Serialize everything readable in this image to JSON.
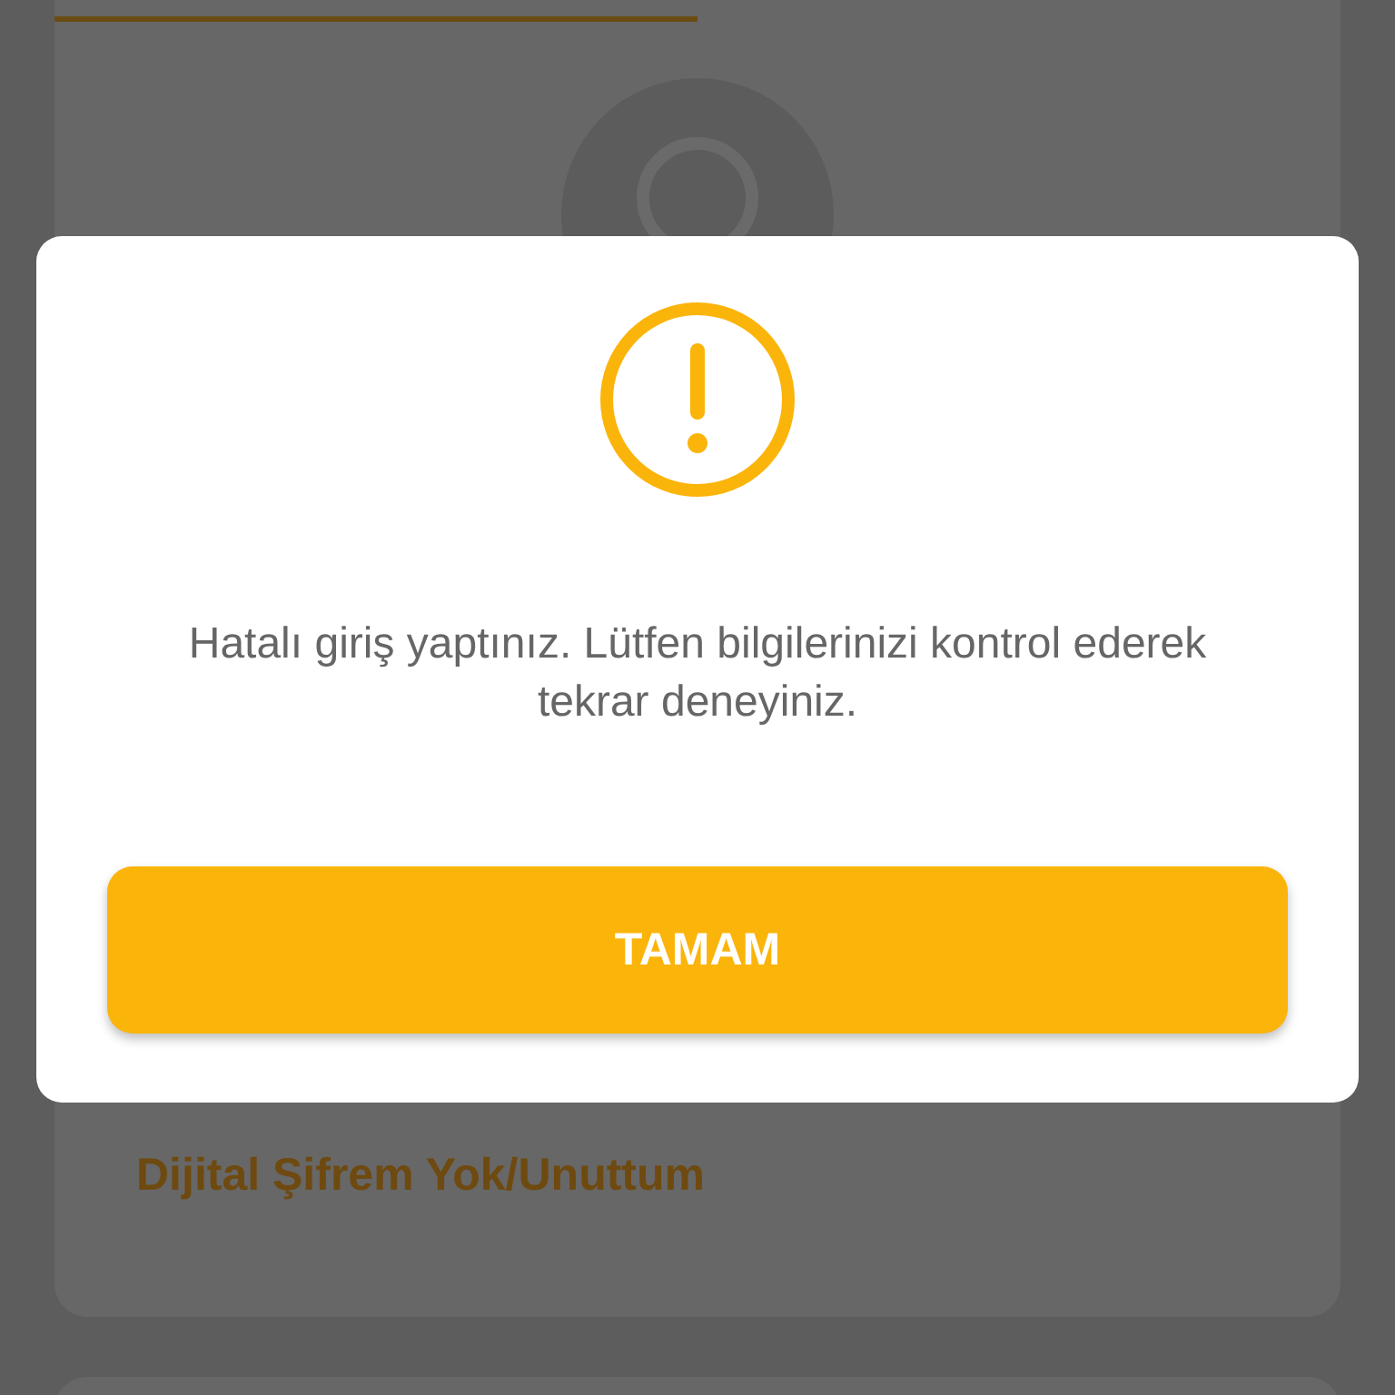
{
  "background": {
    "link": "Dijital Şifrem Yok/Unuttum"
  },
  "dialog": {
    "message": "Hatalı giriş yaptınız. Lütfen bilgilerinizi kontrol ederek tekrar deneyiniz.",
    "button": "TAMAM"
  }
}
